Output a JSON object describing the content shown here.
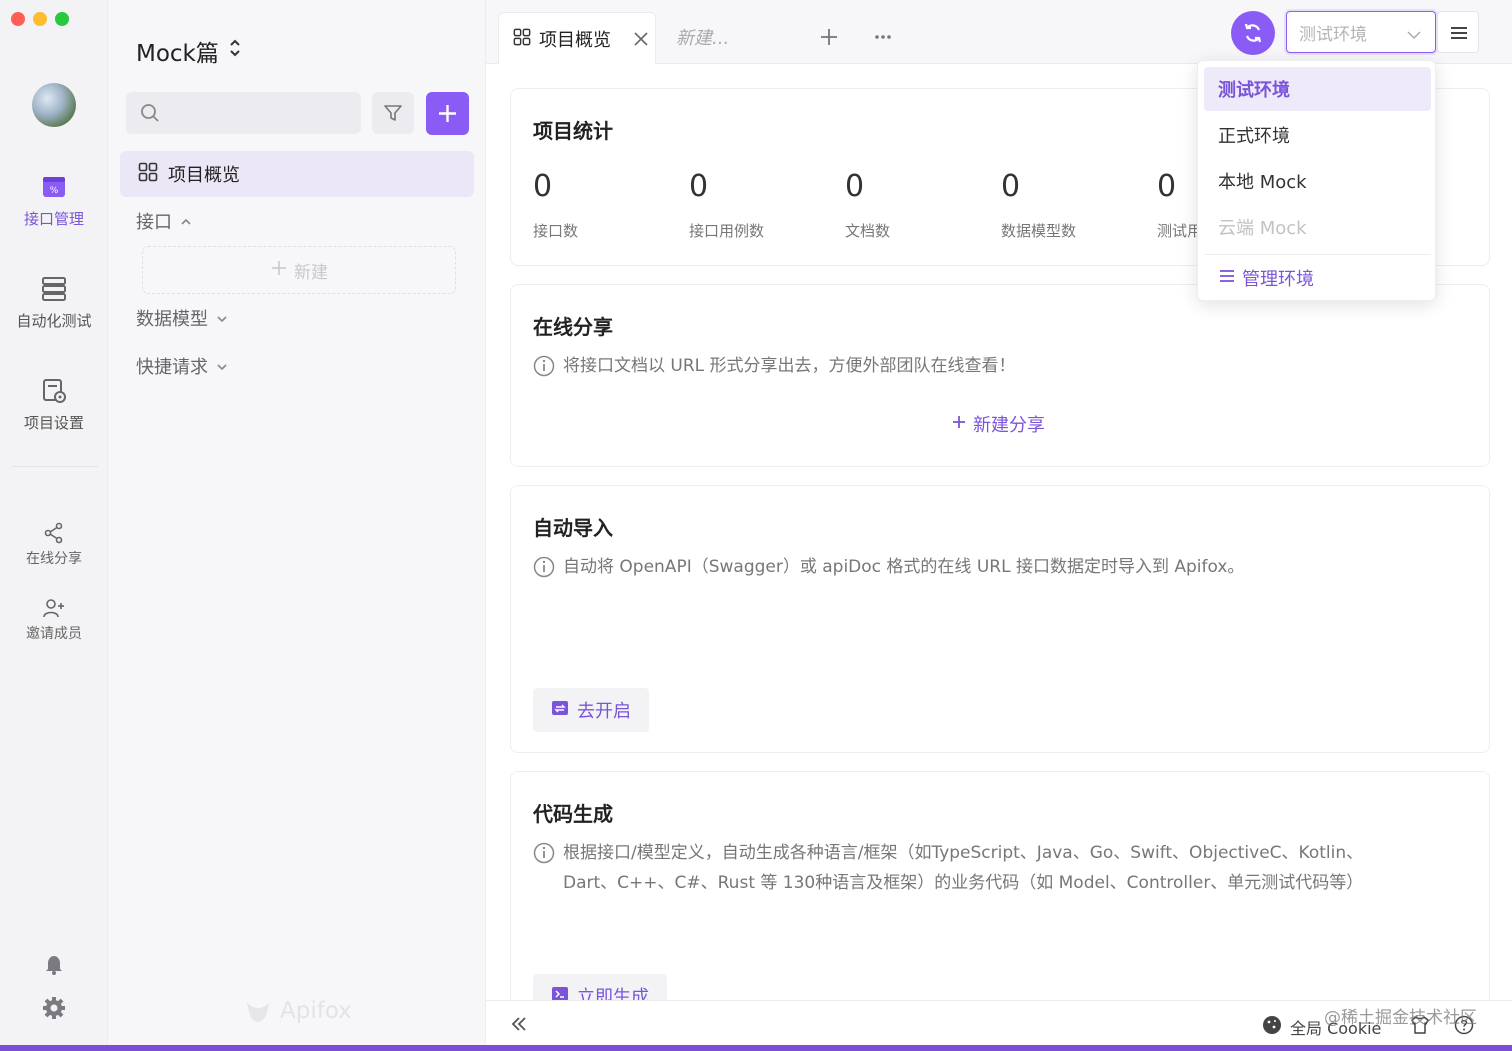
{
  "window": {
    "project_name": "Mock篇"
  },
  "rail": {
    "items": [
      {
        "label": "接口管理",
        "icon": "api-management-icon",
        "active": true
      },
      {
        "label": "自动化测试",
        "icon": "automation-test-icon",
        "active": false
      },
      {
        "label": "项目设置",
        "icon": "project-settings-icon",
        "active": false
      }
    ],
    "secondary": [
      {
        "label": "在线分享",
        "icon": "share-icon"
      },
      {
        "label": "邀请成员",
        "icon": "invite-member-icon"
      }
    ],
    "bottom_icons": [
      "bell-icon",
      "gear-icon"
    ]
  },
  "panel": {
    "search": {
      "placeholder": "",
      "value": ""
    },
    "overview_label": "项目概览",
    "groups": [
      {
        "label": "接口",
        "expanded": true
      },
      {
        "label": "数据模型",
        "expanded": false
      },
      {
        "label": "快捷请求",
        "expanded": false
      }
    ],
    "new_label": "新建",
    "logo_text": "Apifox"
  },
  "tabs": {
    "active_label": "项目概览",
    "new_placeholder": "新建..."
  },
  "env": {
    "selected": "测试环境",
    "options": [
      {
        "label": "测试环境",
        "state": "selected"
      },
      {
        "label": "正式环境",
        "state": "normal"
      },
      {
        "label": "本地 Mock",
        "state": "normal"
      },
      {
        "label": "云端 Mock",
        "state": "disabled"
      }
    ],
    "manage_label": "管理环境"
  },
  "cards": {
    "stats": {
      "title": "项目统计",
      "items": [
        {
          "value": "0",
          "label": "接口数"
        },
        {
          "value": "0",
          "label": "接口用例数"
        },
        {
          "value": "0",
          "label": "文档数"
        },
        {
          "value": "0",
          "label": "数据模型数"
        },
        {
          "value": "0",
          "label": "测试用"
        }
      ]
    },
    "share": {
      "title": "在线分享",
      "desc": "将接口文档以 URL 形式分享出去，方便外部团队在线查看！",
      "action": "新建分享"
    },
    "import": {
      "title": "自动导入",
      "desc": "自动将 OpenAPI（Swagger）或 apiDoc 格式的在线 URL 接口数据定时导入到 Apifox。",
      "action": "去开启"
    },
    "codegen": {
      "title": "代码生成",
      "desc_line1": "根据接口/模型定义，自动生成各种语言/框架（如TypeScript、Java、Go、Swift、ObjectiveC、Kotlin、",
      "desc_line2": "Dart、C++、C#、Rust 等 130种语言及框架）的业务代码（如 Model、Controller、单元测试代码等）",
      "action": "立即生成"
    }
  },
  "bottombar": {
    "cookie_label": "全局 Cookie",
    "watermark": "@稀土掘金技术社区"
  },
  "colors": {
    "accent": "#8a5cf5",
    "accent_text": "#7a55d9"
  }
}
